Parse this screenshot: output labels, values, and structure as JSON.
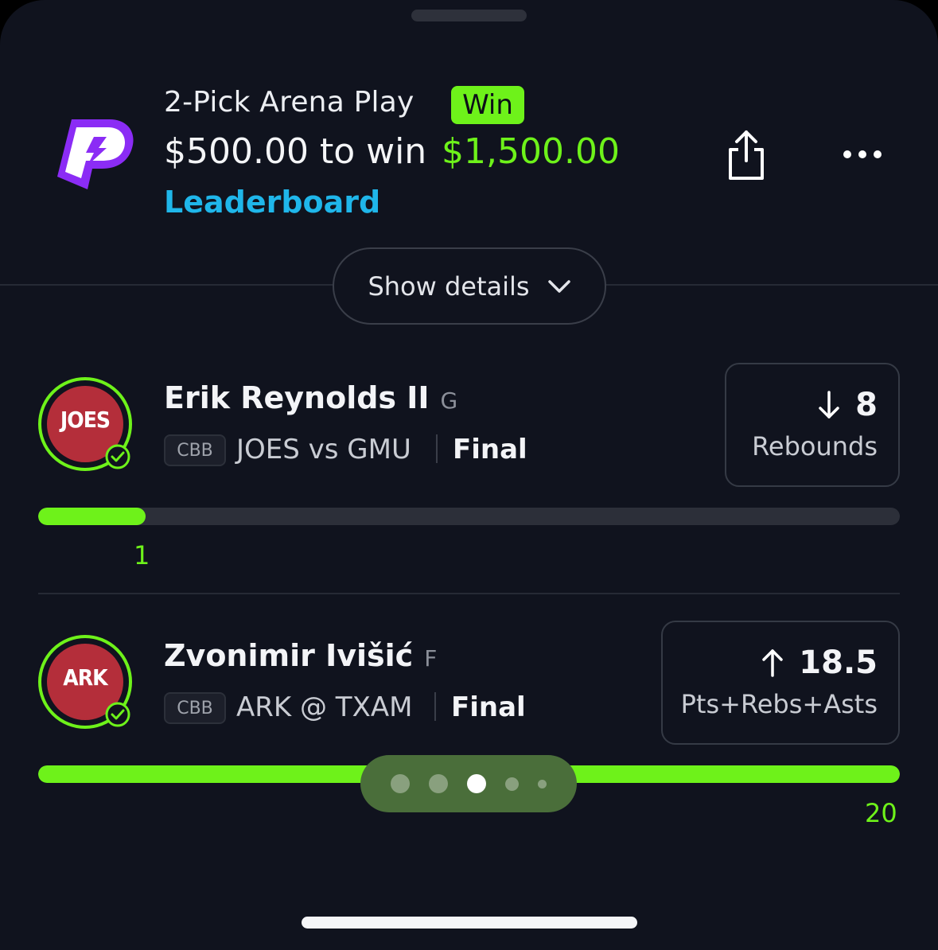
{
  "header": {
    "title": "2-Pick Arena Play",
    "result_badge": "Win",
    "stake_text": "$500.00 to win",
    "payout": "$1,500.00",
    "leaderboard_link": "Leaderboard",
    "icons": {
      "logo": "prizepicks-logo",
      "share": "share-icon",
      "more": "more-icon"
    }
  },
  "details_toggle": {
    "label": "Show details",
    "icon": "chevron-down-icon"
  },
  "picks": [
    {
      "team_short": "JOES",
      "player": "Erik Reynolds II",
      "position": "G",
      "league": "CBB",
      "matchup": "JOES vs GMU",
      "status": "Final",
      "direction": "down",
      "line": "8",
      "stat": "Rebounds",
      "result_value": "1",
      "progress_fraction": 0.125
    },
    {
      "team_short": "ARK",
      "player": "Zvonimir Ivišić",
      "position": "F",
      "league": "CBB",
      "matchup": "ARK @ TXAM",
      "status": "Final",
      "direction": "up",
      "line": "18.5",
      "stat": "Pts+Rebs+Asts",
      "result_value": "20",
      "progress_fraction": 1.0
    }
  ],
  "pager": {
    "count": 5,
    "active_index": 2
  },
  "colors": {
    "accent_green": "#6ef21a",
    "link_blue": "#1fb6ea",
    "background": "#10131e",
    "brand_purple": "#8b2cf5"
  }
}
